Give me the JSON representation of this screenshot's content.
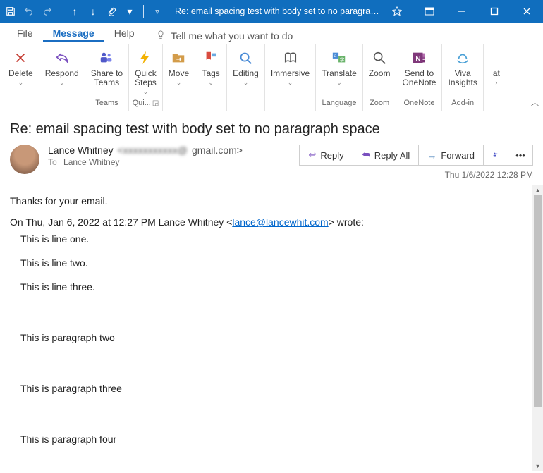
{
  "titlebar": {
    "title": "Re: email spacing test with body set to no paragraph sp...",
    "qat_icons": [
      "save",
      "undo",
      "redo",
      "prev",
      "next",
      "attach",
      "dropdown",
      "customize"
    ]
  },
  "menu": {
    "items": [
      "File",
      "Message",
      "Help"
    ],
    "tell_me": "Tell me what you want to do"
  },
  "ribbon": {
    "groups": [
      {
        "buttons": [
          {
            "icon": "delete",
            "label": "Delete"
          }
        ],
        "label": ""
      },
      {
        "buttons": [
          {
            "icon": "respond",
            "label": "Respond"
          }
        ],
        "label": ""
      },
      {
        "buttons": [
          {
            "icon": "teams",
            "label": "Share to\nTeams"
          }
        ],
        "label": "Teams"
      },
      {
        "buttons": [
          {
            "icon": "quick",
            "label": "Quick\nSteps"
          }
        ],
        "label": "Qui...",
        "dlg": true
      },
      {
        "buttons": [
          {
            "icon": "move",
            "label": "Move"
          }
        ],
        "label": ""
      },
      {
        "buttons": [
          {
            "icon": "tags",
            "label": "Tags"
          }
        ],
        "label": ""
      },
      {
        "buttons": [
          {
            "icon": "editing",
            "label": "Editing"
          }
        ],
        "label": ""
      },
      {
        "buttons": [
          {
            "icon": "immersive",
            "label": "Immersive"
          }
        ],
        "label": ""
      },
      {
        "buttons": [
          {
            "icon": "translate",
            "label": "Translate"
          }
        ],
        "label": "Language"
      },
      {
        "buttons": [
          {
            "icon": "zoom",
            "label": "Zoom"
          }
        ],
        "label": "Zoom"
      },
      {
        "buttons": [
          {
            "icon": "onenote",
            "label": "Send to\nOneNote"
          }
        ],
        "label": "OneNote"
      },
      {
        "buttons": [
          {
            "icon": "viva",
            "label": "Viva\nInsights"
          }
        ],
        "label": "Add-in"
      },
      {
        "buttons": [
          {
            "icon": "at",
            "label": "at"
          }
        ],
        "label": ""
      }
    ]
  },
  "message": {
    "subject": "Re: email spacing test with body set to no paragraph space",
    "sender_name": "Lance Whitney",
    "sender_email": "gmail.com>",
    "to_label": "To",
    "to_name": "Lance Whitney",
    "actions": {
      "reply": "Reply",
      "reply_all": "Reply All",
      "forward": "Forward"
    },
    "date": "Thu 1/6/2022 12:28 PM",
    "body_lines": [
      "Thanks for your email."
    ],
    "quote_intro_pre": "On Thu, Jan 6, 2022 at 12:27 PM Lance Whitney <",
    "quote_intro_link": "lance@lancewhit.com",
    "quote_intro_post": "> wrote:",
    "quoted_lines": [
      "This is line one.",
      "This is line two.",
      "This is line three.",
      "",
      "This is paragraph two",
      "",
      "This is paragraph three",
      "",
      "This is paragraph four"
    ]
  }
}
